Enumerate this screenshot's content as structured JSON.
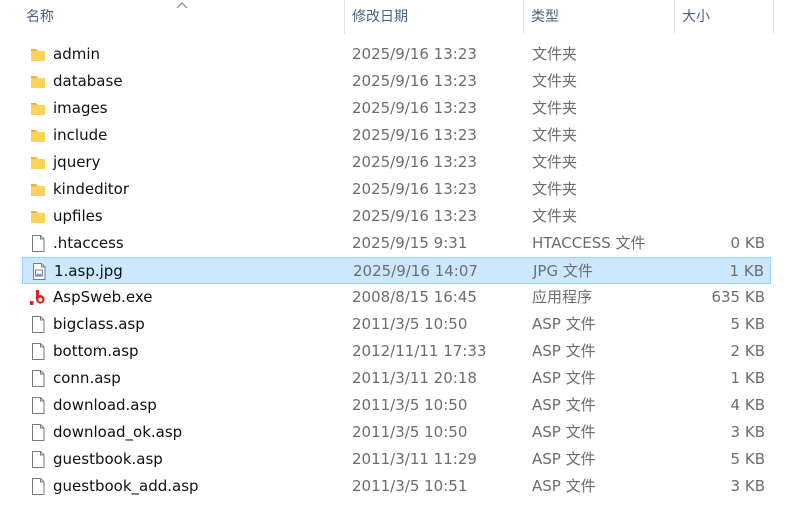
{
  "columns": {
    "name": "名称",
    "modified": "修改日期",
    "type": "类型",
    "size": "大小"
  },
  "files": [
    {
      "name": "admin",
      "modified": "2025/9/16 13:23",
      "type": "文件夹",
      "size": "",
      "icon": "folder-icon"
    },
    {
      "name": "database",
      "modified": "2025/9/16 13:23",
      "type": "文件夹",
      "size": "",
      "icon": "folder-icon"
    },
    {
      "name": "images",
      "modified": "2025/9/16 13:23",
      "type": "文件夹",
      "size": "",
      "icon": "folder-icon"
    },
    {
      "name": "include",
      "modified": "2025/9/16 13:23",
      "type": "文件夹",
      "size": "",
      "icon": "folder-icon"
    },
    {
      "name": "jquery",
      "modified": "2025/9/16 13:23",
      "type": "文件夹",
      "size": "",
      "icon": "folder-icon"
    },
    {
      "name": "kindeditor",
      "modified": "2025/9/16 13:23",
      "type": "文件夹",
      "size": "",
      "icon": "folder-icon"
    },
    {
      "name": "upfiles",
      "modified": "2025/9/16 13:23",
      "type": "文件夹",
      "size": "",
      "icon": "folder-icon"
    },
    {
      "name": ".htaccess",
      "modified": "2025/9/15 9:31",
      "type": "HTACCESS 文件",
      "size": "0 KB",
      "icon": "blank-file-icon"
    },
    {
      "name": "1.asp.jpg",
      "modified": "2025/9/16 14:07",
      "type": "JPG 文件",
      "size": "1 KB",
      "icon": "image-file-icon",
      "selected": true
    },
    {
      "name": "AspSweb.exe",
      "modified": "2008/8/15 16:45",
      "type": "应用程序",
      "size": "635 KB",
      "icon": "app-b-icon"
    },
    {
      "name": "bigclass.asp",
      "modified": "2011/3/5 10:50",
      "type": "ASP 文件",
      "size": "5 KB",
      "icon": "blank-file-icon"
    },
    {
      "name": "bottom.asp",
      "modified": "2012/11/11 17:33",
      "type": "ASP 文件",
      "size": "2 KB",
      "icon": "blank-file-icon"
    },
    {
      "name": "conn.asp",
      "modified": "2011/3/11 20:18",
      "type": "ASP 文件",
      "size": "1 KB",
      "icon": "blank-file-icon"
    },
    {
      "name": "download.asp",
      "modified": "2011/3/5 10:50",
      "type": "ASP 文件",
      "size": "4 KB",
      "icon": "blank-file-icon"
    },
    {
      "name": "download_ok.asp",
      "modified": "2011/3/5 10:50",
      "type": "ASP 文件",
      "size": "3 KB",
      "icon": "blank-file-icon"
    },
    {
      "name": "guestbook.asp",
      "modified": "2011/3/11 11:29",
      "type": "ASP 文件",
      "size": "5 KB",
      "icon": "blank-file-icon"
    },
    {
      "name": "guestbook_add.asp",
      "modified": "2011/3/5 10:51",
      "type": "ASP 文件",
      "size": "3 KB",
      "icon": "blank-file-icon"
    }
  ],
  "colors": {
    "folder": "#f8c73c",
    "selection": "#cce8ff",
    "selection_border": "#99d1ff",
    "header_text": "#4d6082",
    "app_icon": "#e0211b"
  }
}
